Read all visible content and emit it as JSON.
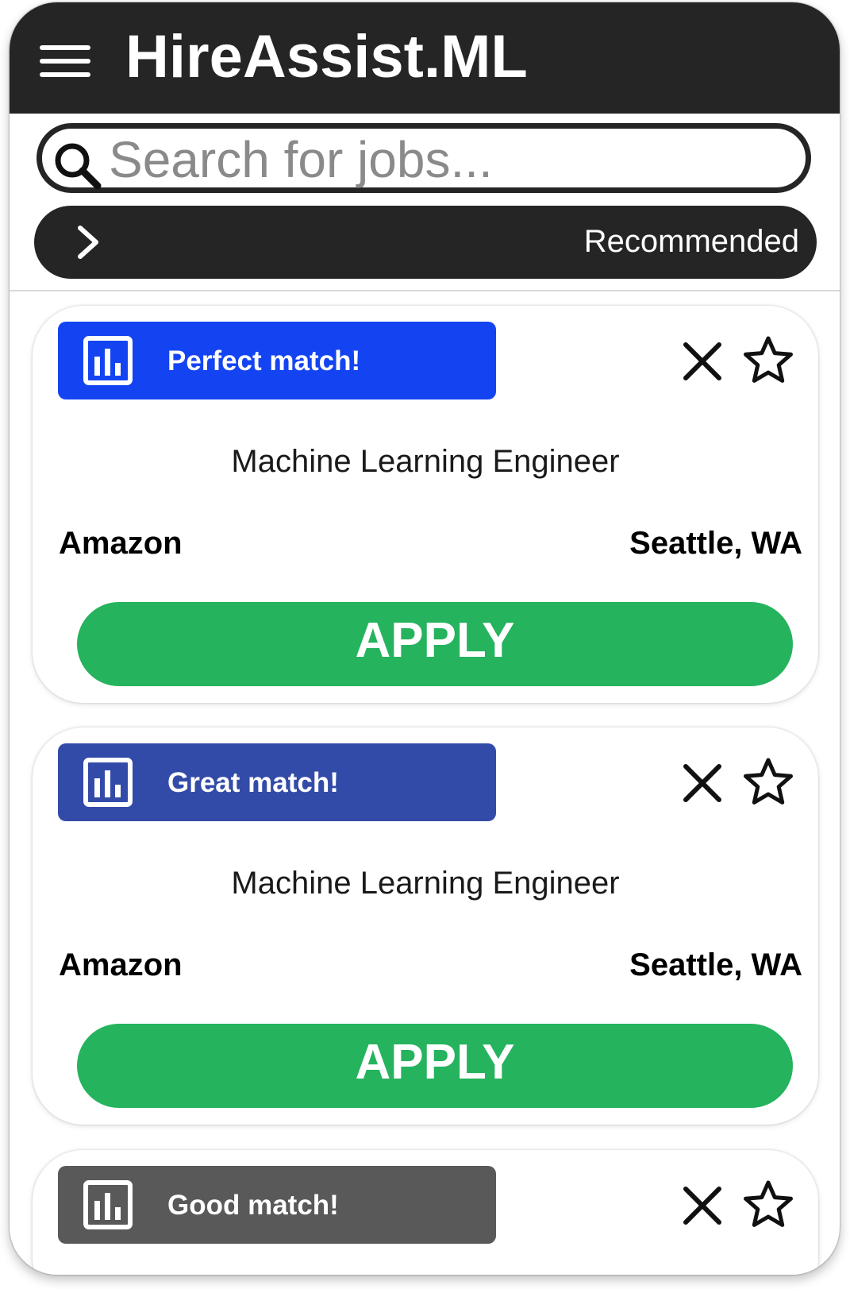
{
  "header": {
    "title": "HireAssist.ML"
  },
  "search": {
    "placeholder": "Search for jobs..."
  },
  "sort": {
    "label": "Recommended"
  },
  "jobs": [
    {
      "match_label": "Perfect match!",
      "match_color": "#1444f2",
      "title": "Machine Learning Engineer",
      "company": "Amazon",
      "location": "Seattle, WA",
      "apply_label": "APPLY"
    },
    {
      "match_label": "Great match!",
      "match_color": "#334ba8",
      "title": "Machine Learning Engineer",
      "company": "Amazon",
      "location": "Seattle, WA",
      "apply_label": "APPLY"
    },
    {
      "match_label": "Good match!",
      "match_color": "#595959"
    }
  ],
  "colors": {
    "header_bg": "#252525",
    "apply_green": "#25b35e"
  },
  "icons": [
    "menu-icon",
    "search-icon",
    "chevron-right-icon",
    "bar-chart-icon",
    "close-icon",
    "star-icon"
  ]
}
